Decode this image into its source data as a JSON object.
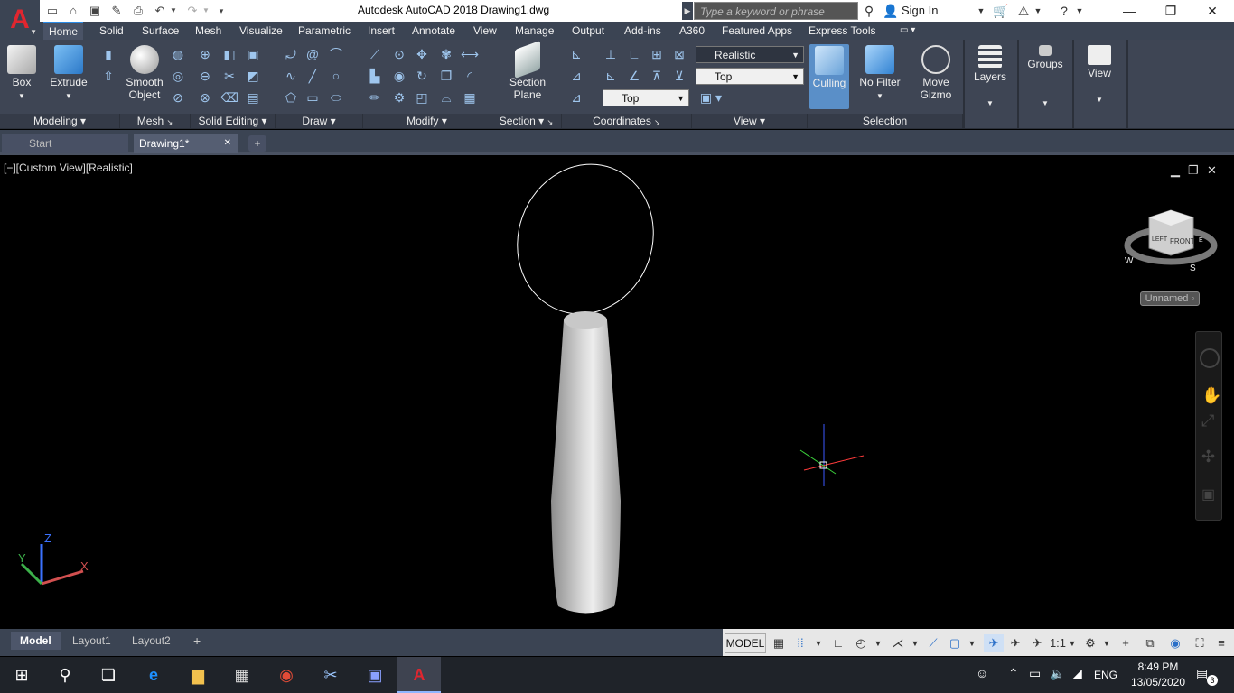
{
  "app": {
    "logo_letter": "A",
    "title": "Autodesk AutoCAD 2018    Drawing1.dwg",
    "search_placeholder": "Type a keyword or phrase",
    "sign_in": "Sign In"
  },
  "ribbon_tabs": [
    "Home",
    "Solid",
    "Surface",
    "Mesh",
    "Visualize",
    "Parametric",
    "Insert",
    "Annotate",
    "View",
    "Manage",
    "Output",
    "Add-ins",
    "A360",
    "Featured Apps",
    "Express Tools"
  ],
  "active_tab": "Home",
  "panels": {
    "modeling": {
      "title": "Modeling",
      "box": "Box",
      "extrude": "Extrude"
    },
    "mesh": {
      "title": "Mesh",
      "smooth_object_line1": "Smooth",
      "smooth_object_line2": "Object"
    },
    "solid_editing": {
      "title": "Solid Editing"
    },
    "draw": {
      "title": "Draw"
    },
    "modify": {
      "title": "Modify"
    },
    "section": {
      "title": "Section",
      "section_plane_line1": "Section",
      "section_plane_line2": "Plane"
    },
    "coordinates": {
      "title": "Coordinates",
      "ucs_combo": "Top"
    },
    "view": {
      "title": "View",
      "visual_style": "Realistic",
      "view_combo": "Top"
    },
    "selection": {
      "title": "Selection",
      "culling": "Culling",
      "no_filter": "No Filter",
      "move_gizmo_line1": "Move",
      "move_gizmo_line2": "Gizmo"
    },
    "layers": {
      "title": "Layers"
    },
    "groups": {
      "title": "Groups"
    },
    "viewpanel": {
      "title": "View"
    }
  },
  "doc_tabs": [
    "Start",
    "Drawing1*"
  ],
  "active_doc": "Drawing1*",
  "viewport": {
    "label": "[−][Custom View][Realistic]",
    "viewcube_face": "FRONT",
    "viewcube_left": "LEFT",
    "compass_w": "W",
    "compass_s": "S",
    "compass_e": "E",
    "ucs_name": "Unnamed",
    "ucs_axis_x": "X",
    "ucs_axis_y": "Y",
    "ucs_axis_z": "Z"
  },
  "layout_tabs": [
    "Model",
    "Layout1",
    "Layout2"
  ],
  "status": {
    "model": "MODEL",
    "scale": "1:1"
  },
  "taskbar": {
    "time": "8:49 PM",
    "date": "13/05/2020",
    "lang": "ENG",
    "notif_count": "3"
  },
  "colors": {
    "ribbon_bg": "#3e4554",
    "tab_bar_bg": "#3b4453",
    "accent_blue": "#2a8be6",
    "autocad_red": "#e0262f"
  }
}
